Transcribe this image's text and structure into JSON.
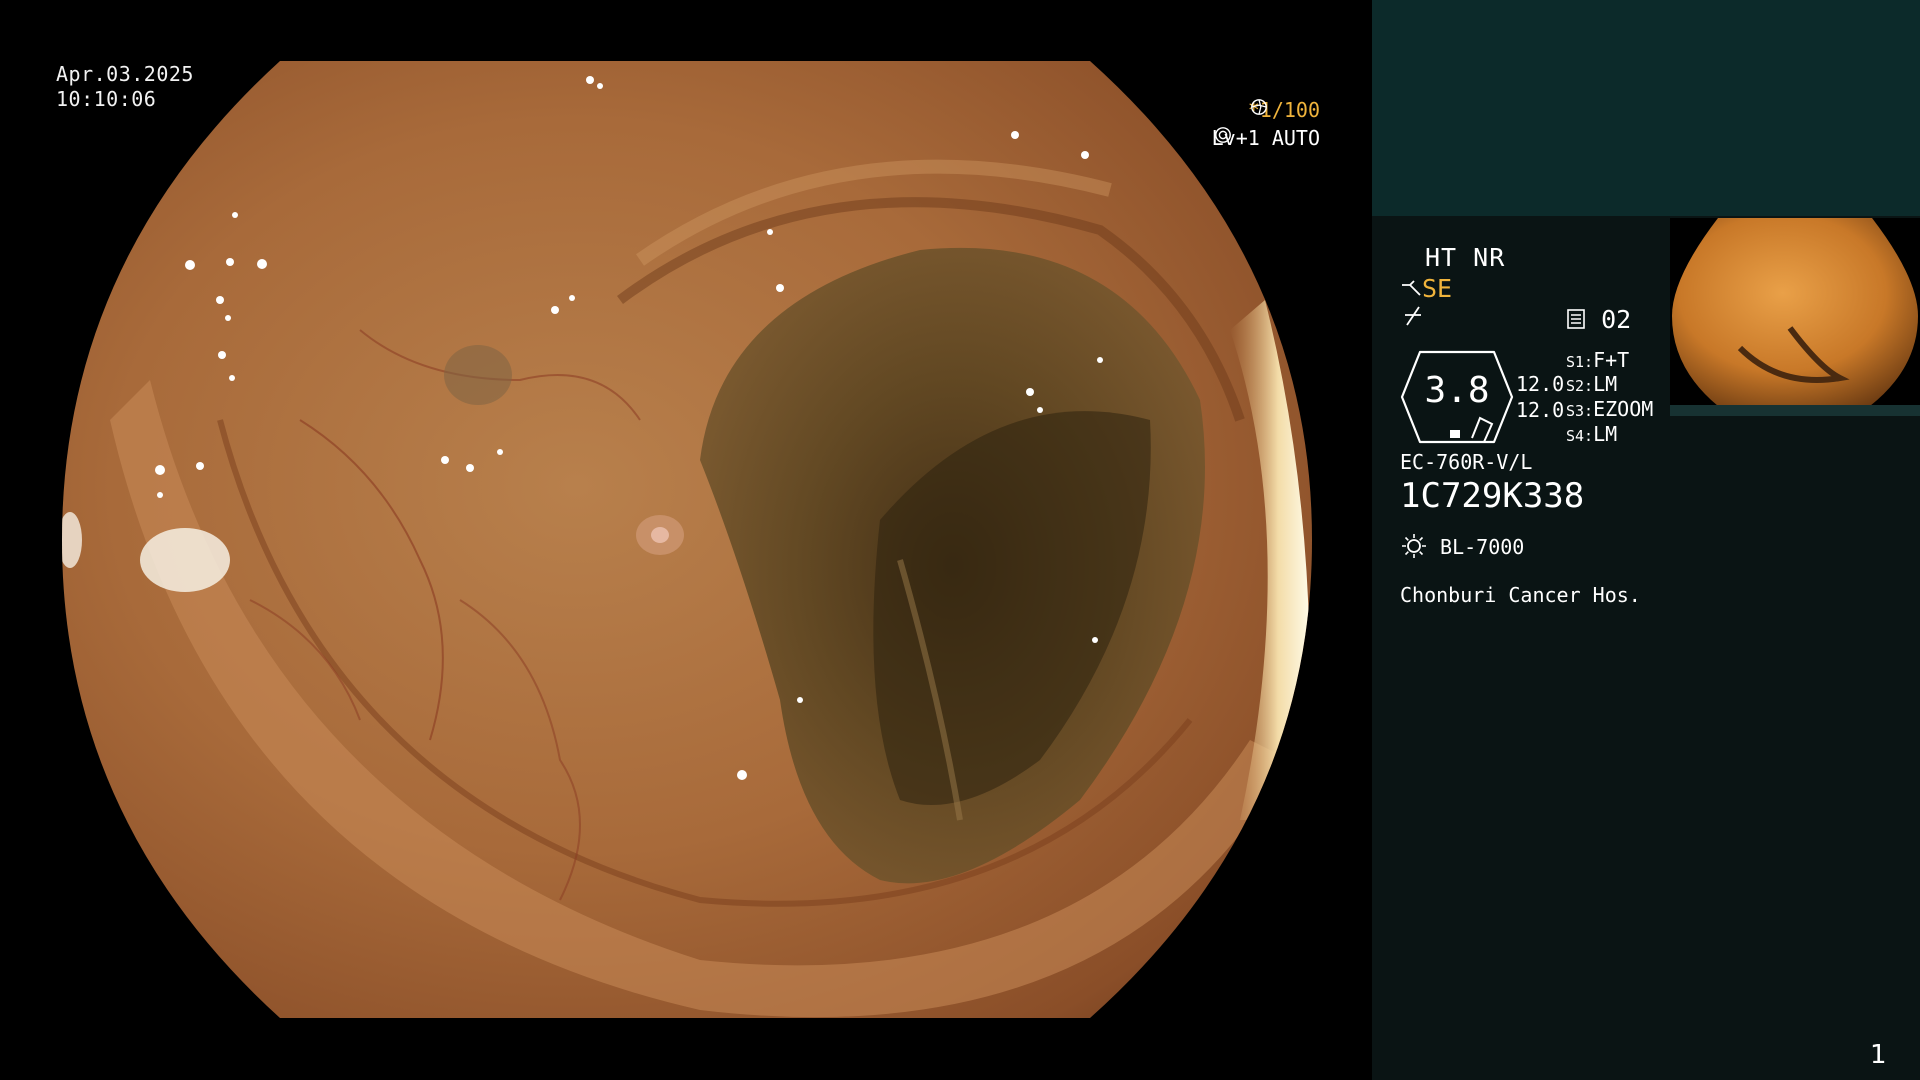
{
  "overlay": {
    "date": "Apr.03.2025",
    "time": "10:10:06",
    "shutter": "*1/100",
    "level": "Lv+1 AUTO"
  },
  "panel": {
    "modes": "HT NR",
    "enhance": "SE",
    "record_number": "02",
    "hex_value": "3.8",
    "color_values": [
      "12.0",
      "12.0"
    ],
    "switches": [
      {
        "key": "S1:",
        "value": "F+T"
      },
      {
        "key": "S2:",
        "value": "LM"
      },
      {
        "key": "S3:",
        "value": "EZOOM"
      },
      {
        "key": "S4:",
        "value": "LM"
      }
    ],
    "scope_model": "EC-760R-V/L",
    "serial": "1C729K338",
    "light_source": "BL-7000",
    "hospital": "Chonburi Cancer Hos.",
    "page_number": "1"
  },
  "colors": {
    "accent_orange": "#f0b43c",
    "panel_bg": "#0a1414",
    "panel_top_bg": "#0c2a2a"
  },
  "icons": [
    "shutter-mode-icon",
    "auto-iris-icon",
    "scope-tip-icon",
    "fuse-icon",
    "record-icon",
    "light-source-icon"
  ]
}
